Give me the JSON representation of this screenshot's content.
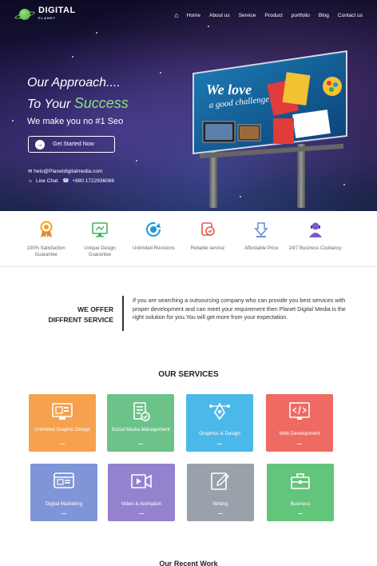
{
  "brand": {
    "name": "DIGITAL",
    "sub": "PLANET"
  },
  "nav": {
    "items": [
      "Home",
      "About us",
      "Service",
      "Product",
      "portfolio",
      "Blog",
      "Contact us"
    ]
  },
  "hero": {
    "line1": "Our Approach....",
    "line2_prefix": "To Your ",
    "line2_accent": "Success",
    "tagline": "We make you no #1 Seo",
    "cta": "Get Started Now",
    "email": "helo@Planetdigitalmedia.com",
    "chat": "Live Chat",
    "phone": "+880 1722936066",
    "billboard_line1": "We love",
    "billboard_line2": "a good challenge!"
  },
  "features": [
    {
      "label": "100% Satisfaction Guarantee",
      "icon": "award-icon",
      "color": "#f0a21f"
    },
    {
      "label": "Unique Design Guarantee",
      "icon": "monitor-icon",
      "color": "#3fb35a"
    },
    {
      "label": "Unlimited Revisions",
      "icon": "refresh-icon",
      "color": "#1b9ad6"
    },
    {
      "label": "Reliable service",
      "icon": "reliable-icon",
      "color": "#e6574b"
    },
    {
      "label": "Affordable Price",
      "icon": "price-icon",
      "color": "#6b8fd6"
    },
    {
      "label": "24/7 Business Coultancy",
      "icon": "consultant-icon",
      "color": "#7b5cc4"
    }
  ],
  "offer": {
    "title_line1": "WE OFFER",
    "title_line2": "DIFFRENT SERVICE",
    "text": "If you are searching a outsourcing company who can provide you best services with proper development and can meet your requirement then Planet Digital Media is the right solution for you.You will get more from your expectation."
  },
  "services": {
    "title": "OUR SERVICES",
    "items": [
      {
        "label": "Unlimited Graphic Design",
        "color": "#f5a14d",
        "icon": "design-icon"
      },
      {
        "label": "Social Media Management",
        "color": "#6cc38a",
        "icon": "social-icon"
      },
      {
        "label": "Graphics & Design",
        "color": "#4bb8ea",
        "icon": "pen-tool-icon"
      },
      {
        "label": "Web Development",
        "color": "#ef6a63",
        "icon": "code-icon"
      },
      {
        "label": "Digital Marketing",
        "color": "#7f95d8",
        "icon": "browser-icon"
      },
      {
        "label": "Video & Animation",
        "color": "#9482cf",
        "icon": "video-icon"
      },
      {
        "label": "Writing",
        "color": "#9aa1aa",
        "icon": "write-icon"
      },
      {
        "label": "Business",
        "color": "#63c47c",
        "icon": "briefcase-icon"
      }
    ]
  },
  "recent": {
    "title": "Our Recent  Work"
  }
}
